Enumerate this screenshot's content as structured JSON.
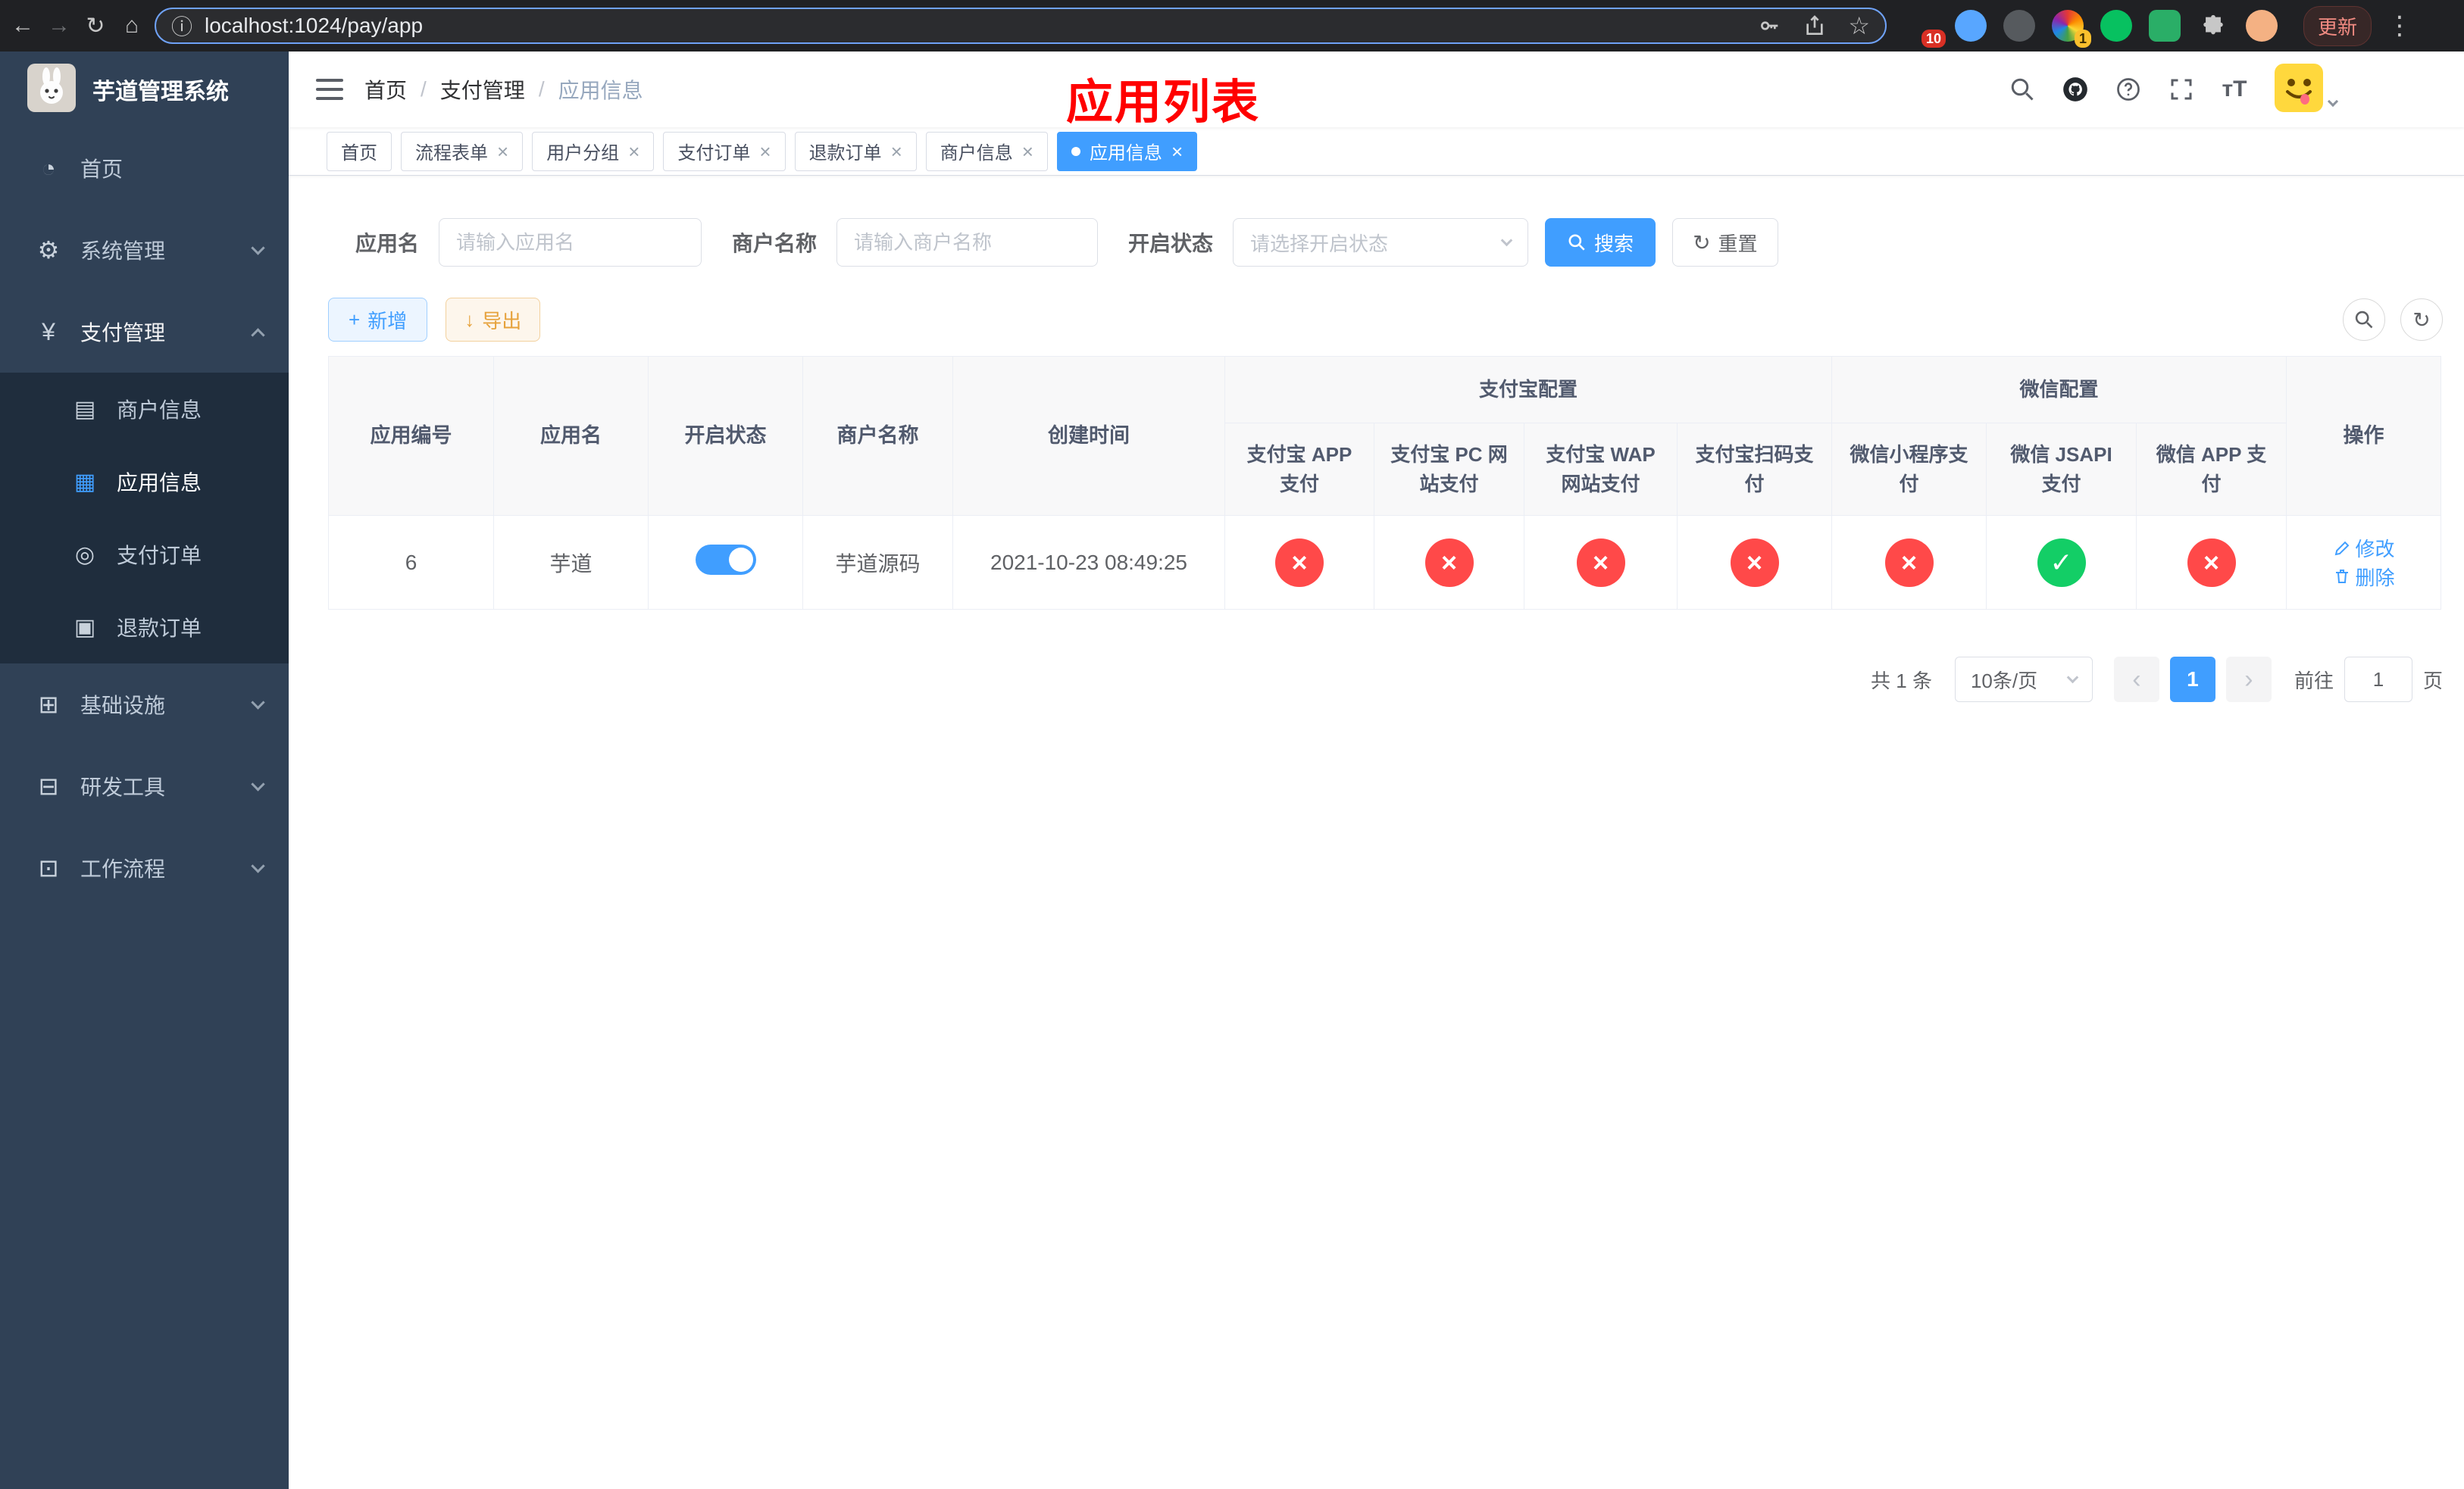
{
  "browser": {
    "url": "localhost:1024/pay/app",
    "update_label": "更新",
    "extension_badge_1": "10",
    "extension_badge_2": "1"
  },
  "sidebar": {
    "logo_title": "芋道管理系统",
    "home": "首页",
    "system": "系统管理",
    "payment": "支付管理",
    "merchant_info": "商户信息",
    "app_info": "应用信息",
    "pay_order": "支付订单",
    "refund_order": "退款订单",
    "infrastructure": "基础设施",
    "dev_tools": "研发工具",
    "workflow": "工作流程"
  },
  "navbar": {
    "breadcrumb": [
      "首页",
      "支付管理",
      "应用信息"
    ],
    "overlay_title": "应用列表"
  },
  "tabs": [
    {
      "label": "首页"
    },
    {
      "label": "流程表单"
    },
    {
      "label": "用户分组"
    },
    {
      "label": "支付订单"
    },
    {
      "label": "退款订单"
    },
    {
      "label": "商户信息"
    },
    {
      "label": "应用信息"
    }
  ],
  "filters": {
    "app_name_label": "应用名",
    "app_name_placeholder": "请输入应用名",
    "merchant_label": "商户名称",
    "merchant_placeholder": "请输入商户名称",
    "status_label": "开启状态",
    "status_placeholder": "请选择开启状态",
    "search_button": "搜索",
    "reset_button": "重置"
  },
  "toolbar": {
    "add_button": "新增",
    "export_button": "导出"
  },
  "table": {
    "col_id": "应用编号",
    "col_name": "应用名",
    "col_status": "开启状态",
    "col_merchant": "商户名称",
    "col_created": "创建时间",
    "group_alipay": "支付宝配置",
    "group_wechat": "微信配置",
    "col_alipay_app": "支付宝 APP 支付",
    "col_alipay_pc": "支付宝 PC 网站支付",
    "col_alipay_wap": "支付宝 WAP 网站支付",
    "col_alipay_qr": "支付宝扫码支付",
    "col_wechat_mini": "微信小程序支付",
    "col_wechat_jsapi": "微信 JSAPI 支付",
    "col_wechat_app": "微信 APP 支付",
    "col_actions": "操作",
    "row": {
      "id": "6",
      "name": "芋道",
      "enabled": true,
      "merchant": "芋道源码",
      "created": "2021-10-23 08:49:25",
      "alipay_app": "no",
      "alipay_pc": "no",
      "alipay_wap": "no",
      "alipay_qr": "no",
      "wechat_mini": "no",
      "wechat_jsapi": "yes",
      "wechat_app": "no",
      "edit": "修改",
      "delete": "删除"
    }
  },
  "pagination": {
    "total": "共 1 条",
    "page_size": "10条/页",
    "page": "1",
    "goto_prefix": "前往",
    "goto_value": "1",
    "goto_suffix": "页"
  },
  "icons": {
    "back": "←",
    "forward": "→",
    "reload": "↻",
    "home": "⌂",
    "info": "ⓘ",
    "star": "☆",
    "kebab": "⋮",
    "dashboard": "◔",
    "gear": "⚙",
    "yen": "¥",
    "merchant": "▤",
    "app_grid": "▦",
    "order": "◎",
    "refund": "▣",
    "infra": "⊞",
    "devtools": "⊟",
    "workflow": "⊡",
    "size": "тT",
    "plus": "+",
    "download": "↓",
    "refresh": "↻",
    "close": "×",
    "check": "✓",
    "cross": "×",
    "prev": "‹",
    "next": "›",
    "crumb_sep": "/"
  },
  "colors": {
    "primary": "#409eff",
    "danger": "#ff4949",
    "success": "#13ce66",
    "warning": "#e6a23c",
    "sidebar_bg": "#304156",
    "submenu_bg": "#1f2d3d",
    "overlay_title_red": "#ff0000"
  }
}
